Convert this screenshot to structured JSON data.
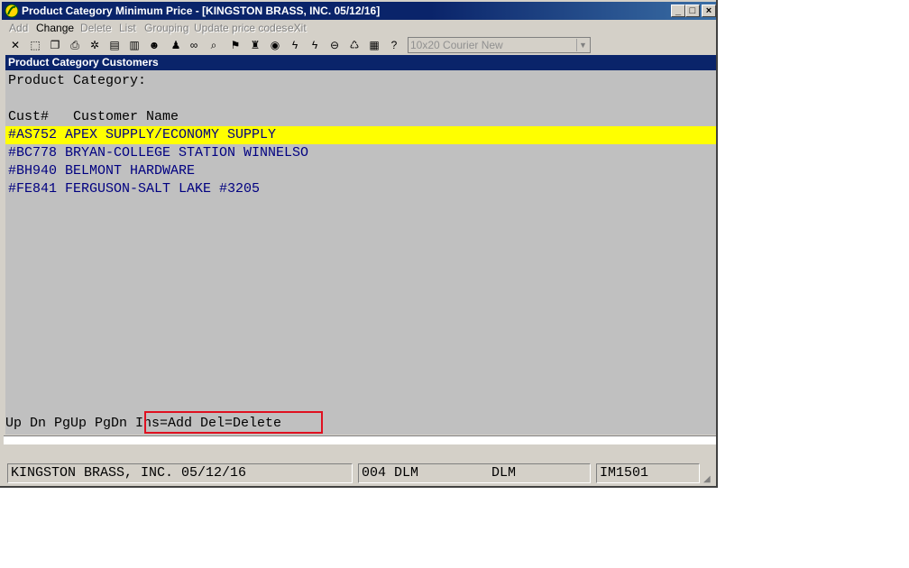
{
  "window": {
    "title": "Product Category Minimum Price - [KINGSTON BRASS, INC. 05/12/16]",
    "buttons": {
      "minimize": "_",
      "maximize": "□",
      "close": "×"
    }
  },
  "menu": [
    "Add",
    "Change",
    "Delete",
    "List",
    "Grouping",
    "Update price codes",
    "eXit"
  ],
  "menu_enabled": [
    "Change"
  ],
  "toolbar": {
    "icons": [
      "close-x-icon",
      "select-icon",
      "copy-icon",
      "print-icon",
      "tools-icon",
      "properties-icon",
      "notes-icon",
      "customer-icon",
      "person-icon",
      "search-icon",
      "run-icon",
      "person-run-icon",
      "binoculars-icon",
      "palette-icon",
      "lightning-icon",
      "lightning2-icon",
      "link-icon",
      "chart-icon",
      "book-icon",
      "help-icon"
    ],
    "font_selector": "10x20 Courier New"
  },
  "panel": {
    "header": "Product Category Customers",
    "category_label": "Product Category:",
    "columns_header": "Cust#   Customer Name",
    "rows": [
      "#AS752 APEX SUPPLY/ECONOMY SUPPLY",
      "#BC778 BRYAN-COLLEGE STATION WINNELSO",
      "#BH940 BELMONT HARDWARE",
      "#FE841 FERGUSON-SALT LAKE #3205"
    ],
    "hint_nav": "Up Dn PgUp PgDn ",
    "hint_keys": "Ins=Add Del=Delete"
  },
  "status": {
    "company": "KINGSTON BRASS, INC. 05/12/16",
    "user": "004 DLM         DLM",
    "program": "IM1501"
  },
  "colors": {
    "selected_row": "#ffff00",
    "header_bg": "#0a246a",
    "highlight_box": "#e01020"
  }
}
